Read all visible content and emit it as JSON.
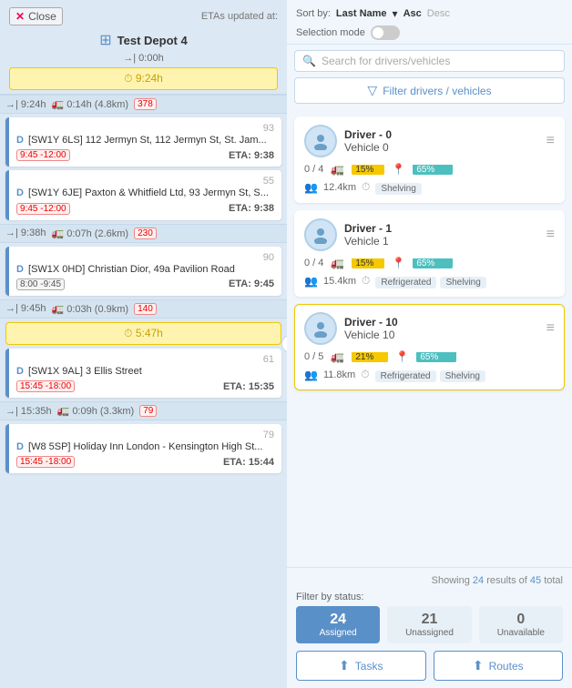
{
  "left": {
    "close_label": "Close",
    "eta_label": "ETAs updated at:",
    "depot_name": "Test Depot 4",
    "depot_arrow": "→| 0:00h",
    "yellow_bar_time": "⏱ 9:24h",
    "separator1": {
      "time": "→| 9:24h",
      "dist_time": "🚛 0:14h (4.8km)",
      "count": "378"
    },
    "stop1": {
      "num": "93",
      "d": "D",
      "postcode": "[SW1Y 6LS]",
      "address": "112 Jermyn St, 112 Jermyn St, St. Jam...",
      "window": "9:45 -12:00",
      "eta_label": "ETA:",
      "eta": "9:38"
    },
    "stop2": {
      "num": "55",
      "d": "D",
      "postcode": "[SW1Y 6JE]",
      "address": "Paxton & Whitfield Ltd, 93 Jermyn St, S...",
      "window": "9:45 -12:00",
      "eta_label": "ETA:",
      "eta": "9:38"
    },
    "separator2": {
      "time": "→| 9:38h",
      "dist_time": "🚛 0:07h (2.6km)",
      "count": "230"
    },
    "stop3": {
      "num": "90",
      "d": "D",
      "postcode": "[SW1X 0HD]",
      "address": "Christian Dior, 49a Pavilion Road",
      "window": "8:00 -9:45",
      "eta_label": "ETA:",
      "eta": "9:45"
    },
    "separator3": {
      "time": "→| 9:45h",
      "dist_time": "🚛 0:03h (0.9km)",
      "count": "140"
    },
    "yellow_bar2_time": "⏱ 5:47h",
    "stop4": {
      "num": "61",
      "d": "D",
      "postcode": "[SW1X 9AL]",
      "address": "3 Ellis Street",
      "window": "15:45 -18:00",
      "eta_label": "ETA:",
      "eta": "15:35"
    },
    "separator4": {
      "time": "→| 15:35h",
      "dist_time": "🚛 0:09h (3.3km)",
      "count": "79"
    },
    "stop5": {
      "num": "79",
      "d": "D",
      "postcode": "[W8 5SP]",
      "address": "Holiday Inn London - Kensington High St...",
      "window": "15:45 -18:00",
      "eta_label": "ETA:",
      "eta": "15:44"
    }
  },
  "right": {
    "sort_label": "Sort by:",
    "sort_field": "Last Name",
    "sort_asc": "Asc",
    "sort_desc": "Desc",
    "selection_mode_label": "Selection mode",
    "search_placeholder": "Search for drivers/vehicles",
    "filter_label": "Filter drivers / vehicles",
    "drivers": [
      {
        "id": "driver-0",
        "name": "Driver - 0",
        "vehicle": "Vehicle 0",
        "orders": "0 / 4",
        "yellow_pct": 15,
        "yellow_label": "15%",
        "teal_pct": 65,
        "teal_label": "65%",
        "distance": "12.4km",
        "tags": [
          "Shelving"
        ],
        "selected": false
      },
      {
        "id": "driver-1",
        "name": "Driver - 1",
        "vehicle": "Vehicle 1",
        "orders": "0 / 4",
        "yellow_pct": 15,
        "yellow_label": "15%",
        "teal_pct": 65,
        "teal_label": "65%",
        "distance": "15.4km",
        "tags": [
          "Refrigerated",
          "Shelving"
        ],
        "selected": false
      },
      {
        "id": "driver-10",
        "name": "Driver - 10",
        "vehicle": "Vehicle 10",
        "orders": "0 / 5",
        "yellow_pct": 21,
        "yellow_label": "21%",
        "teal_pct": 65,
        "teal_label": "65%",
        "distance": "11.8km",
        "tags": [
          "Refrigerated",
          "Shelving"
        ],
        "selected": true
      }
    ],
    "showing": {
      "results": "24",
      "total": "45",
      "label": "Showing",
      "of": "results of",
      "totalLabel": "total"
    },
    "filter_status_label": "Filter by status:",
    "status_tabs": [
      {
        "num": "24",
        "label": "Assigned",
        "active": true
      },
      {
        "num": "21",
        "label": "Unassigned",
        "active": false
      },
      {
        "num": "0",
        "label": "Unavailable",
        "active": false
      }
    ],
    "buttons": [
      {
        "label": "Tasks",
        "icon": "⬆"
      },
      {
        "label": "Routes",
        "icon": "⬆"
      }
    ]
  }
}
